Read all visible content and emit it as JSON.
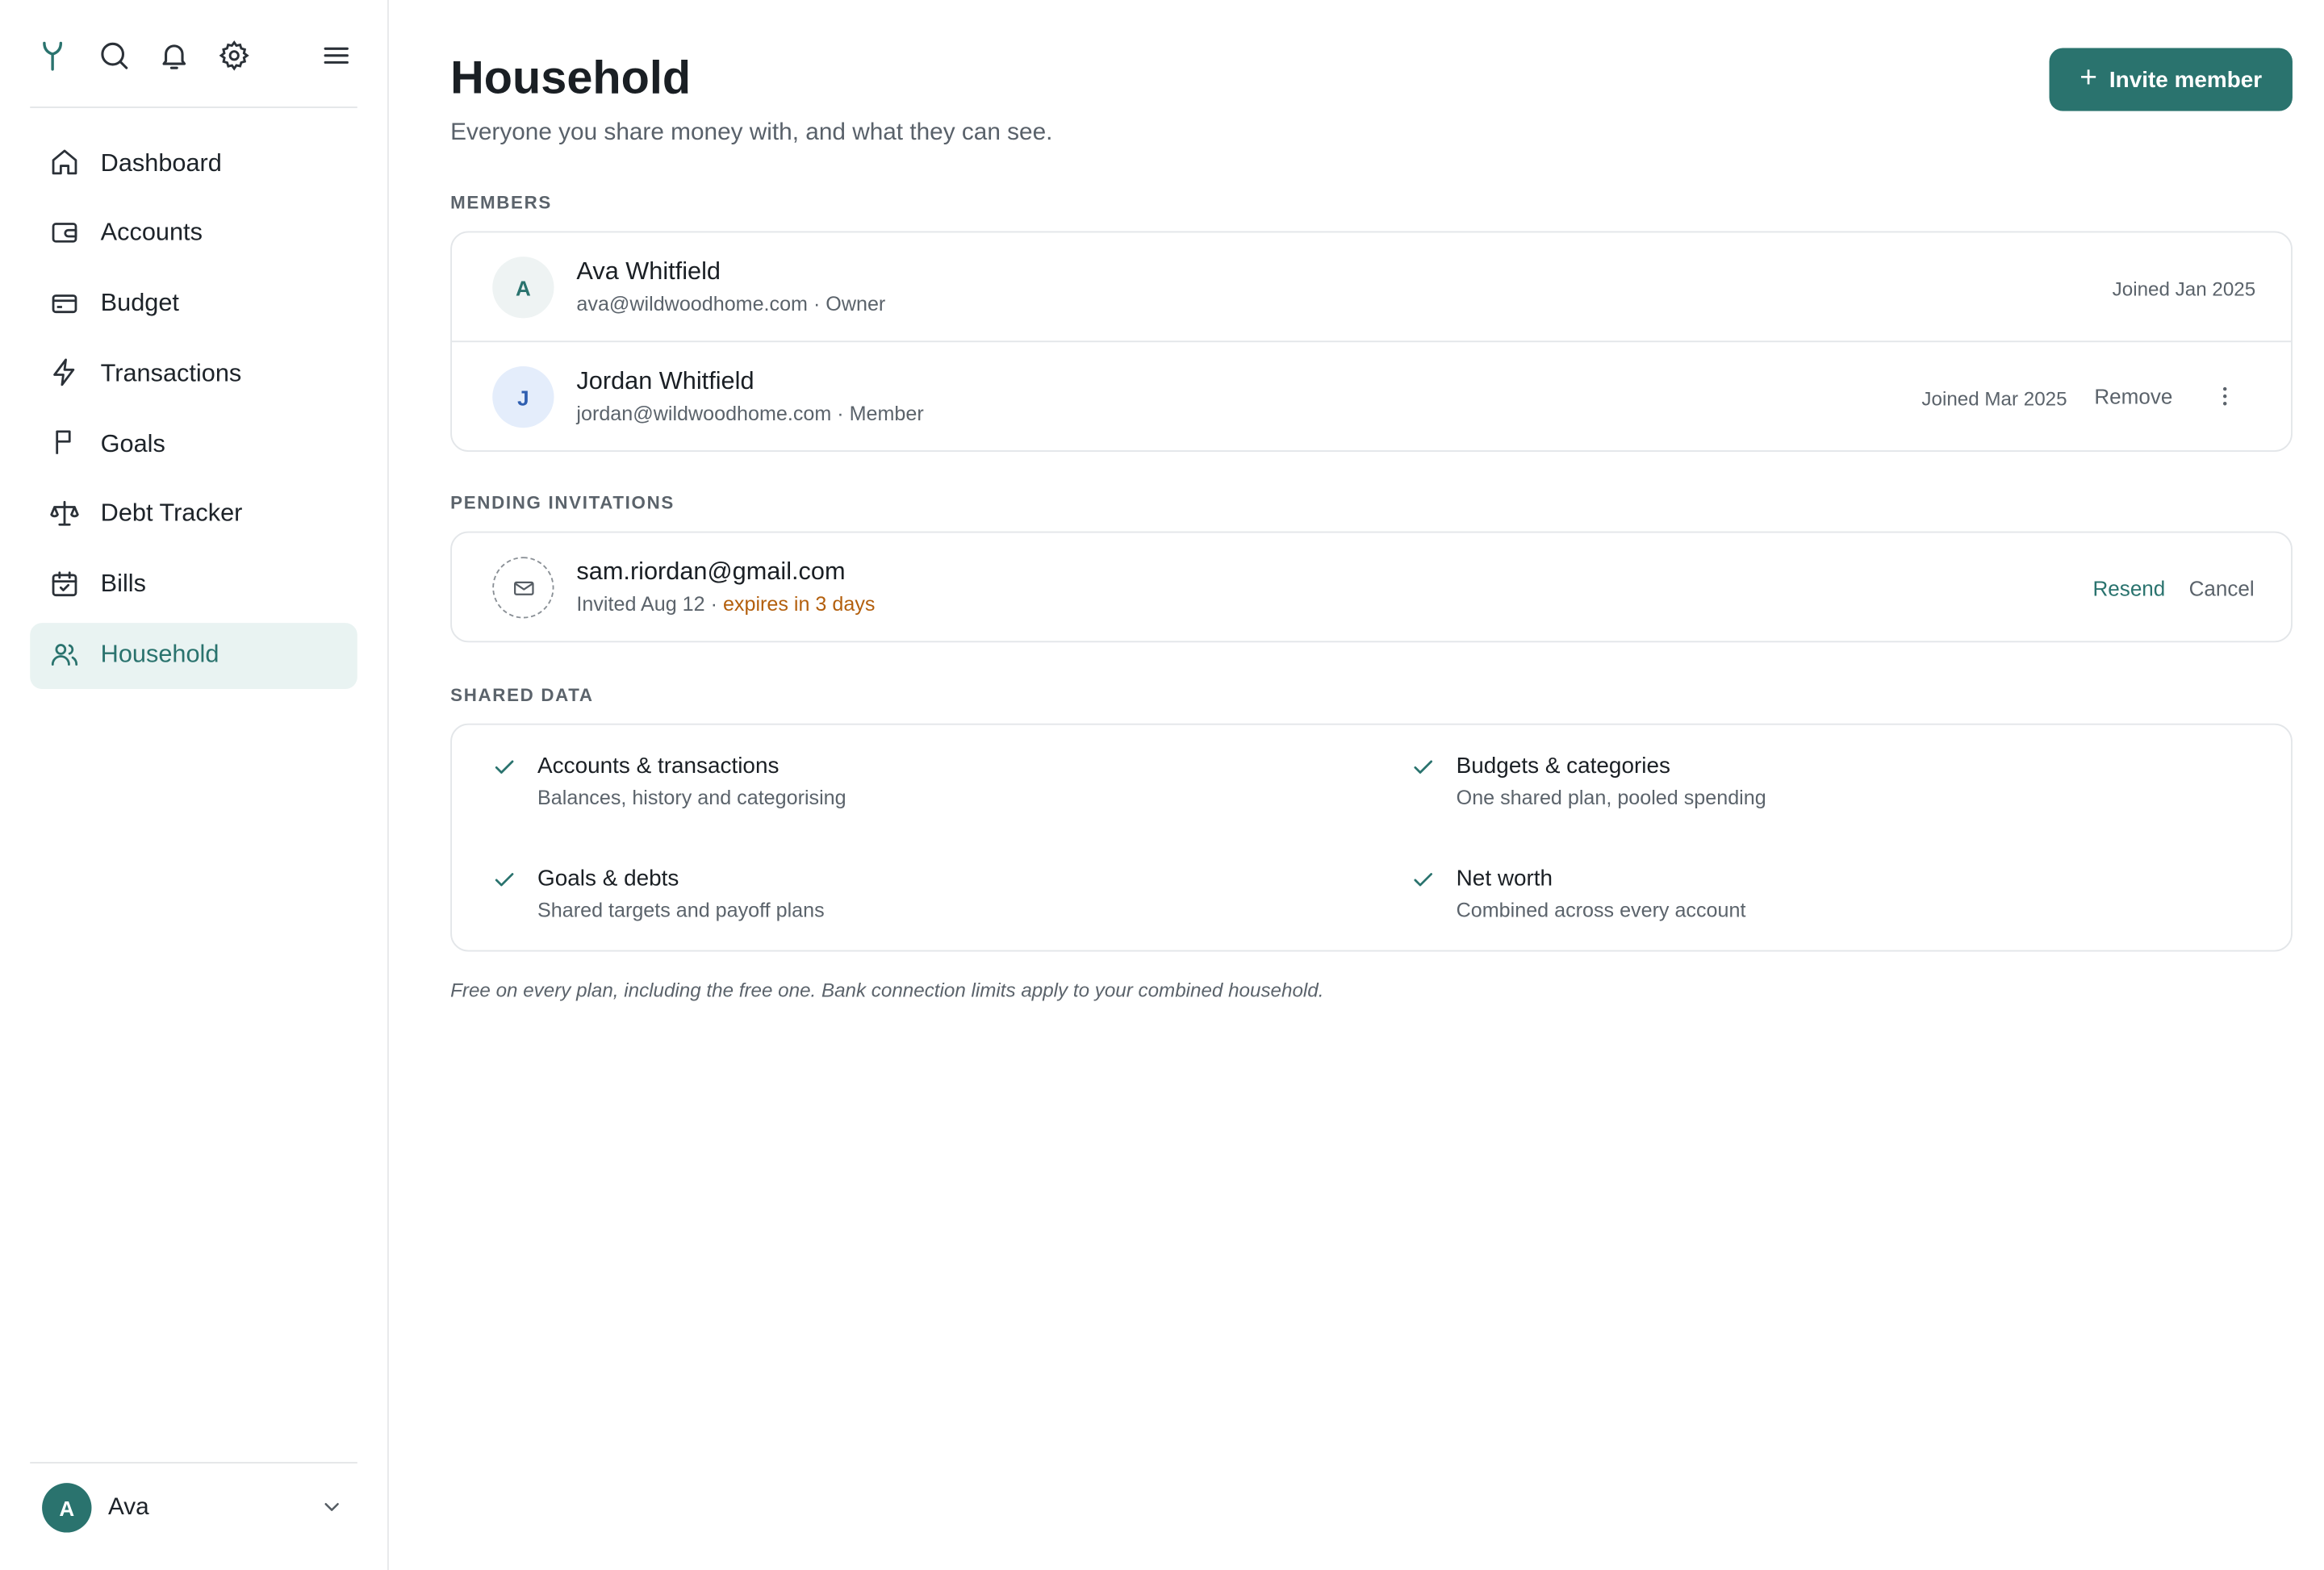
{
  "sidebar": {
    "top_icons": [
      "logo-icon",
      "search-icon",
      "bell-icon",
      "gear-icon",
      "menu-icon"
    ],
    "items": [
      {
        "label": "Dashboard",
        "icon": "home-icon"
      },
      {
        "label": "Accounts",
        "icon": "wallet-icon"
      },
      {
        "label": "Budget",
        "icon": "credit-card-icon"
      },
      {
        "label": "Transactions",
        "icon": "lightning-icon"
      },
      {
        "label": "Goals",
        "icon": "flag-icon"
      },
      {
        "label": "Debt Tracker",
        "icon": "scale-icon"
      },
      {
        "label": "Bills",
        "icon": "calendar-check-icon"
      },
      {
        "label": "Household",
        "icon": "users-icon",
        "active": true
      }
    ],
    "user": {
      "initial": "A",
      "name": "Ava"
    }
  },
  "header": {
    "title": "Household",
    "subtitle": "Everyone you share money with, and what they can see.",
    "invite_label": "Invite member"
  },
  "members": {
    "label": "Members",
    "rows": [
      {
        "initial": "A",
        "name": "Ava Whitfield",
        "detail": "ava@wildwoodhome.com · Owner",
        "joined": "Joined Jan 2025"
      },
      {
        "initial": "J",
        "name": "Jordan Whitfield",
        "detail": "jordan@wildwoodhome.com · Member",
        "joined": "Joined Mar 2025",
        "remove_label": "Remove"
      }
    ]
  },
  "pending": {
    "label": "Pending invitations",
    "invite": {
      "email": "sam.riordan@gmail.com",
      "invited": "Invited Aug 12 · ",
      "expires": "expires in 3 days",
      "resend_label": "Resend",
      "cancel_label": "Cancel"
    }
  },
  "shared": {
    "label": "Shared data",
    "items": [
      {
        "title": "Accounts & transactions",
        "desc": "Balances, history and categorising"
      },
      {
        "title": "Budgets & categories",
        "desc": "One shared plan, pooled spending"
      },
      {
        "title": "Goals & debts",
        "desc": "Shared targets and payoff plans"
      },
      {
        "title": "Net worth",
        "desc": "Combined across every account"
      }
    ]
  },
  "footnote": "Free on every plan, including the free one. Bank connection limits apply to your combined household.",
  "colors": {
    "accent": "#2a736e",
    "warning": "#b35f0d",
    "active_bg": "#e9f3f2",
    "avatar_j_bg": "#e4edfb"
  }
}
